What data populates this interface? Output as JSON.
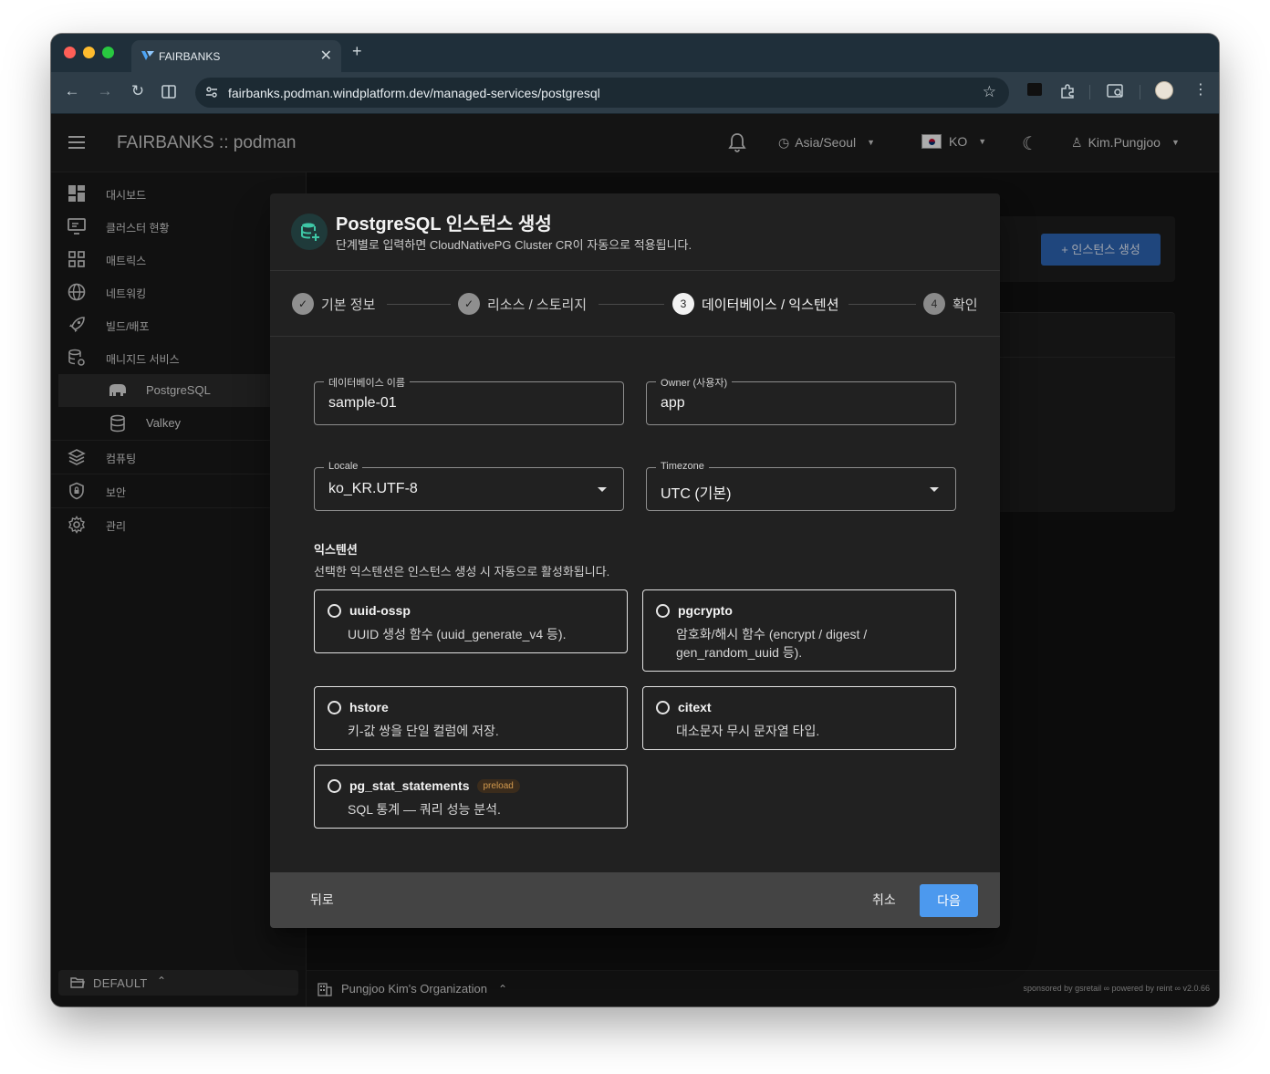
{
  "browser": {
    "tab_title": "FAIRBANKS",
    "tab_close": "✕",
    "new_tab": "+",
    "url": "fairbanks.podman.windplatform.dev/managed-services/postgresql",
    "colors": {
      "close": "#ff5f57",
      "minimize": "#febc2e",
      "zoom": "#28c840"
    }
  },
  "header": {
    "title": "FAIRBANKS :: podman",
    "timezone": "Asia/Seoul",
    "language": "KO",
    "user": "Kim.Pungjoo"
  },
  "sidebar": {
    "items": [
      {
        "label": "대시보드",
        "icon": "dashboard-icon"
      },
      {
        "label": "클러스터 현황",
        "icon": "monitor-icon"
      },
      {
        "label": "매트릭스",
        "icon": "grid-icon"
      },
      {
        "label": "네트워킹",
        "icon": "globe-icon"
      },
      {
        "label": "빌드/배포",
        "icon": "rocket-icon"
      },
      {
        "label": "매니지드 서비스",
        "icon": "database-gear-icon"
      }
    ],
    "sub_items": [
      {
        "label": "PostgreSQL",
        "icon": "elephant-icon",
        "active": true
      },
      {
        "label": "Valkey",
        "icon": "database-icon",
        "active": false
      }
    ],
    "items_after": [
      {
        "label": "컴퓨팅",
        "icon": "layers-icon"
      },
      {
        "label": "보안",
        "icon": "shield-icon"
      },
      {
        "label": "관리",
        "icon": "gear-icon"
      }
    ],
    "workspace": "DEFAULT"
  },
  "footer": {
    "organization": "Pungjoo Kim's Organization",
    "sponsor": "sponsored by gsretail ∞ powered by reint ∞ v2.0.66"
  },
  "page": {
    "create_button": "+ 인스턴스 생성"
  },
  "dialog": {
    "title": "PostgreSQL 인스턴스 생성",
    "subtitle": "단계별로 입력하면 CloudNativePG Cluster CR이 자동으로 적용됩니다.",
    "steps": [
      {
        "label": "기본 정보",
        "state": "done",
        "marker": "✓"
      },
      {
        "label": "리소스 / 스토리지",
        "state": "done",
        "marker": "✓"
      },
      {
        "label": "데이터베이스 / 익스텐션",
        "state": "active",
        "marker": "3"
      },
      {
        "label": "확인",
        "state": "todo",
        "marker": "4"
      }
    ],
    "fields": {
      "database_name": {
        "label": "데이터베이스 이름",
        "value": "sample-01"
      },
      "owner": {
        "label": "Owner (사용자)",
        "value": "app"
      },
      "locale": {
        "label": "Locale",
        "value": "ko_KR.UTF-8"
      },
      "timezone": {
        "label": "Timezone",
        "value": "UTC (기본)"
      }
    },
    "extensions": {
      "title": "익스텐션",
      "description": "선택한 익스텐션은 인스턴스 생성 시 자동으로 활성화됩니다.",
      "items": [
        {
          "name": "uuid-ossp",
          "desc": "UUID 생성 함수 (uuid_generate_v4 등).",
          "selected": false
        },
        {
          "name": "pgcrypto",
          "desc": "암호화/해시 함수 (encrypt / digest / gen_random_uuid 등).",
          "selected": false
        },
        {
          "name": "hstore",
          "desc": "키-값 쌍을 단일 컬럼에 저장.",
          "selected": false
        },
        {
          "name": "citext",
          "desc": "대소문자 무시 문자열 타입.",
          "selected": false
        },
        {
          "name": "pg_stat_statements",
          "badge": "preload",
          "desc": "SQL 통계 — 쿼리 성능 분석.",
          "selected": false
        }
      ]
    },
    "actions": {
      "back": "뒤로",
      "cancel": "취소",
      "next": "다음"
    }
  }
}
